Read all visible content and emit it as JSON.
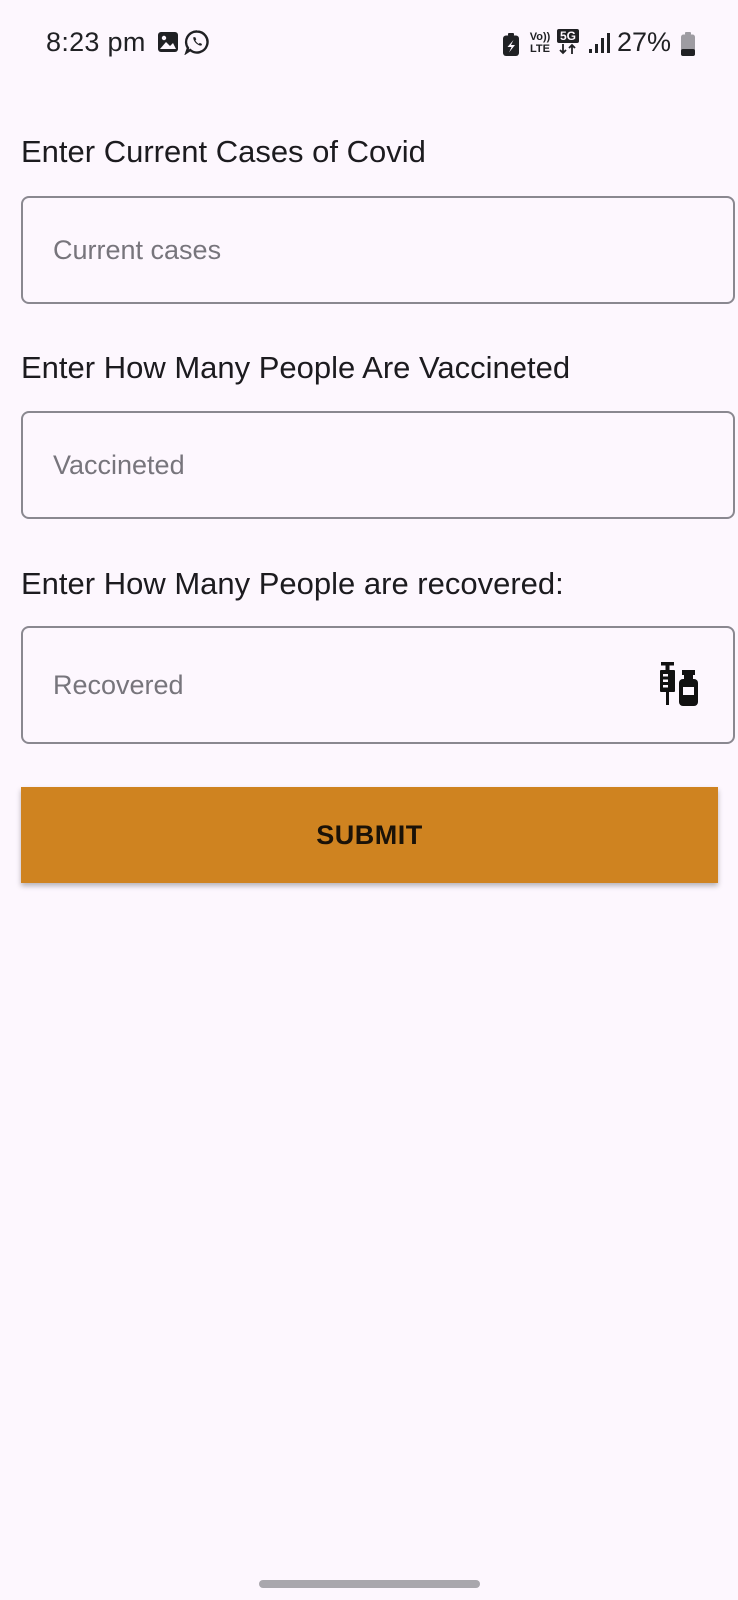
{
  "status_bar": {
    "time": "8:23 pm",
    "battery_percent": "27%",
    "network_type": "5G",
    "volte_label_top": "Vo))",
    "volte_label_bottom": "LTE",
    "icons": [
      "gallery-icon",
      "whatsapp-icon",
      "battery-saver-icon",
      "volte-icon",
      "5g-data-icon",
      "signal-icon",
      "battery-icon"
    ]
  },
  "form": {
    "current_cases": {
      "label": "Enter Current Cases of Covid",
      "placeholder": "Current cases",
      "value": ""
    },
    "vaccinated": {
      "label": "Enter How Many People Are Vaccineted",
      "placeholder": "Vaccineted",
      "value": ""
    },
    "recovered": {
      "label": "Enter How Many People are recovered:",
      "placeholder": "Recovered",
      "value": "",
      "trailing_icon": "vaccine-icon"
    },
    "submit_label": "SUBMIT"
  },
  "colors": {
    "background": "#fdf7fe",
    "submit_button": "#cf8320",
    "field_border": "#8a8890",
    "placeholder": "#77757c"
  }
}
